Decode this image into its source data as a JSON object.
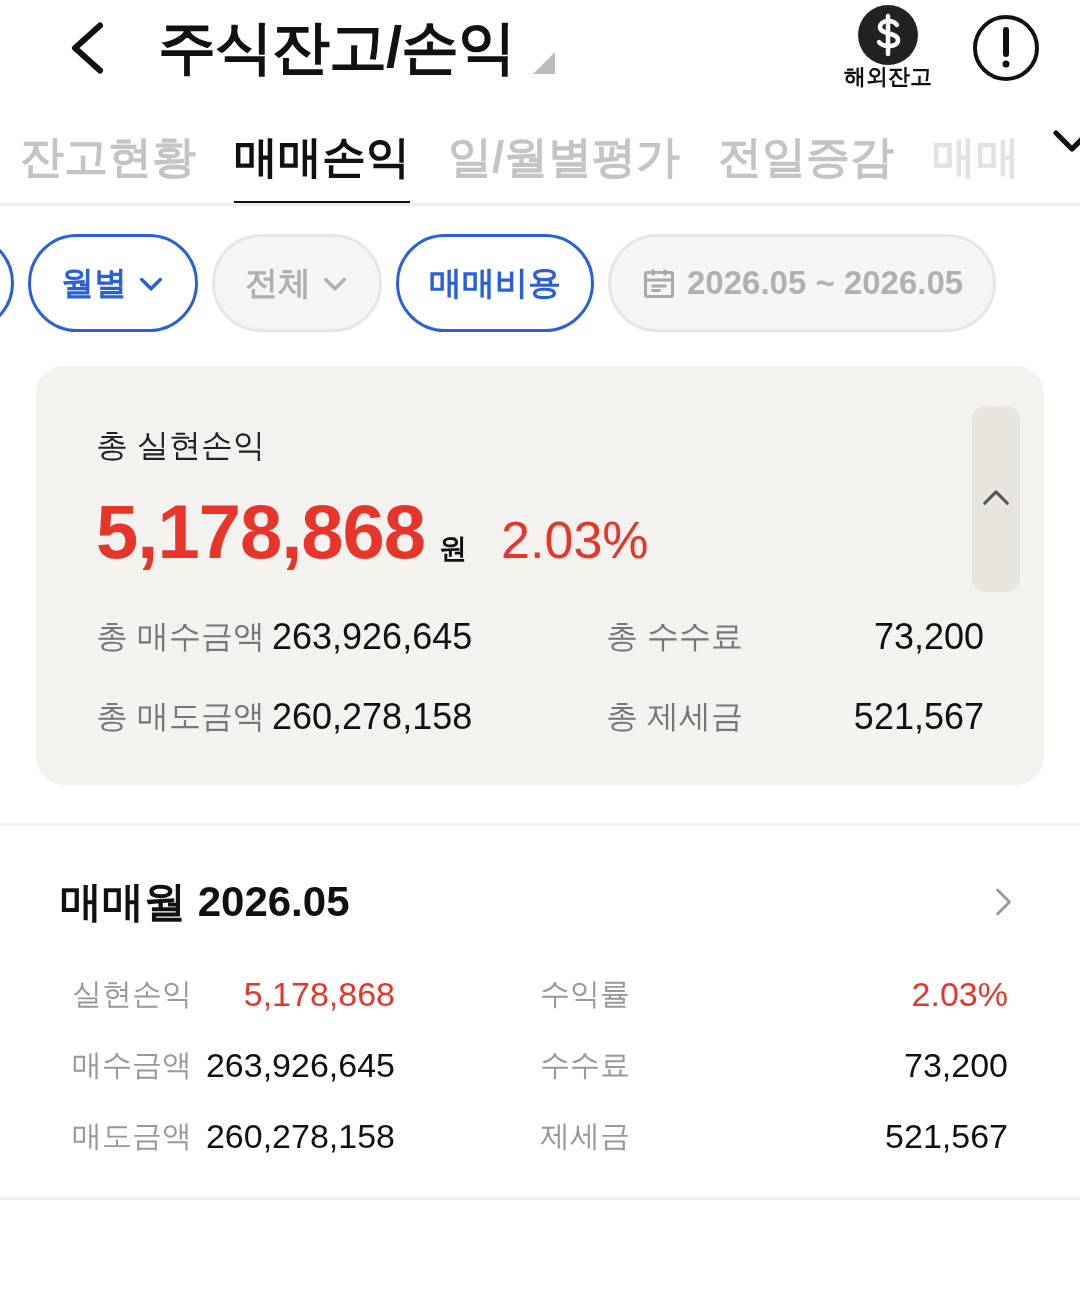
{
  "header": {
    "title": "주식잔고/손익",
    "overseas_label": "해외잔고"
  },
  "tabs": [
    {
      "label": "잔고현황",
      "selected": false
    },
    {
      "label": "매매손익",
      "selected": true
    },
    {
      "label": "일/월별평가",
      "selected": false
    },
    {
      "label": "전일증감",
      "selected": false
    },
    {
      "label": "매매",
      "selected": false
    }
  ],
  "filters": [
    {
      "kind": "stub",
      "active": true
    },
    {
      "kind": "dropdown",
      "label": "월별",
      "active": true
    },
    {
      "kind": "dropdown",
      "label": "전체",
      "active": false
    },
    {
      "kind": "toggle",
      "label": "매매비용",
      "active": true
    },
    {
      "kind": "date",
      "label": "2026.05 ~ 2026.05",
      "active": false
    }
  ],
  "summary": {
    "title": "총 실현손익",
    "amount": "5,178,868",
    "unit": "원",
    "rate": "2.03%",
    "expanded": true,
    "rows": [
      [
        {
          "label": "총 매수금액",
          "value": "263,926,645"
        },
        {
          "label": "총 수수료",
          "value": "73,200"
        }
      ],
      [
        {
          "label": "총 매도금액",
          "value": "260,278,158"
        },
        {
          "label": "총 제세금",
          "value": "521,567"
        }
      ]
    ]
  },
  "month": {
    "title": "매매월 2026.05",
    "rows": [
      [
        {
          "label": "실현손익",
          "value": "5,178,868",
          "kind": "profit"
        },
        {
          "label": "수익률",
          "value": "2.03%",
          "kind": "profit"
        }
      ],
      [
        {
          "label": "매수금액",
          "value": "263,926,645",
          "kind": "plain"
        },
        {
          "label": "수수료",
          "value": "73,200",
          "kind": "plain"
        }
      ],
      [
        {
          "label": "매도금액",
          "value": "260,278,158",
          "kind": "plain"
        },
        {
          "label": "제세금",
          "value": "521,567",
          "kind": "plain"
        }
      ]
    ]
  }
}
